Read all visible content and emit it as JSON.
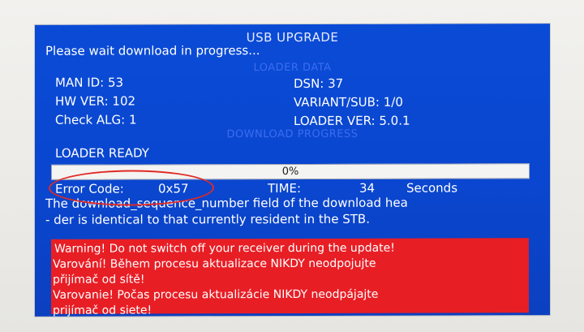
{
  "window": {
    "title": "USB UPGRADE",
    "status_line": "Please wait download in progress..."
  },
  "loader_data": {
    "section_title": "LOADER DATA",
    "man_id": "MAN ID: 53",
    "hw_ver": "HW VER: 102",
    "check_alg": "Check ALG: 1",
    "dsn": "DSN: 37",
    "variant_sub": "VARIANT/SUB: 1/0",
    "loader_ver": "LOADER VER: 5.0.1"
  },
  "download_progress": {
    "section_title": "DOWNLOAD PROGRESS",
    "state": "LOADER READY",
    "percent_text": "0%",
    "progress": 0
  },
  "error": {
    "code_label": "Error Code:",
    "code_value": "0x57",
    "time_label": "TIME:",
    "time_value": "34",
    "time_unit": "Seconds",
    "message_line1": "The download_sequence_number field of the download hea",
    "message_line2": "- der is identical to that currently resident in the STB."
  },
  "warning": {
    "lines": [
      "Warning! Do not switch off your receiver during the update!",
      "Varování! Během procesu aktualizace NIKDY neodpojujte",
      "přijímač od sítě!",
      "Varovanie! Počas procesu aktualizácie NIKDY neodpájajte",
      "prijímač od siete!"
    ]
  },
  "colors": {
    "screen_blue": "#0a4bd6",
    "warning_red": "#e81e25",
    "annotation_red": "#e12b26"
  }
}
